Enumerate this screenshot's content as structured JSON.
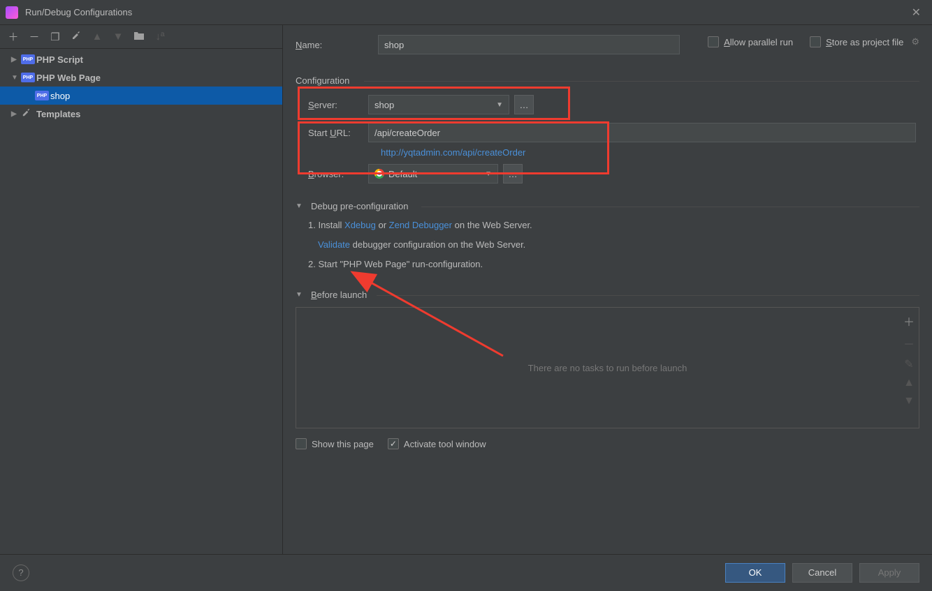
{
  "window": {
    "title": "Run/Debug Configurations"
  },
  "toolbar": {
    "add": "+",
    "remove": "−",
    "copy": "⧉",
    "edit": "🔧",
    "up": "▲",
    "down": "▼",
    "folder": "📁",
    "sort": "↓ª"
  },
  "tree": {
    "php_script": "PHP Script",
    "php_web_page": "PHP Web Page",
    "shop_child": "shop",
    "templates": "Templates"
  },
  "form": {
    "name_label": "Name:",
    "name_value": "shop",
    "allow_parallel": "Allow parallel run",
    "store_project": "Store as project file"
  },
  "config": {
    "legend": "Configuration",
    "server_label": "Server:",
    "server_value": "shop",
    "start_url_label": "Start URL:",
    "start_url_value": "/api/createOrder",
    "resolved_url": "http://yqtadmin.com/api/createOrder",
    "browser_label": "Browser:",
    "browser_value": "Default"
  },
  "debug": {
    "header": "Debug pre-configuration",
    "step1_prefix": "1. Install ",
    "xdebug": "Xdebug",
    "or": " or ",
    "zend": "Zend Debugger",
    "step1_suffix": " on the Web Server.",
    "validate": "Validate",
    "validate_suffix": " debugger configuration on the Web Server.",
    "step2": "2. Start \"PHP Web Page\" run-configuration."
  },
  "before": {
    "header": "Before launch",
    "empty": "There are no tasks to run before launch"
  },
  "bottom": {
    "show_page": "Show this page",
    "activate_tool": "Activate tool window"
  },
  "footer": {
    "ok": "OK",
    "cancel": "Cancel",
    "apply": "Apply",
    "help": "?"
  }
}
